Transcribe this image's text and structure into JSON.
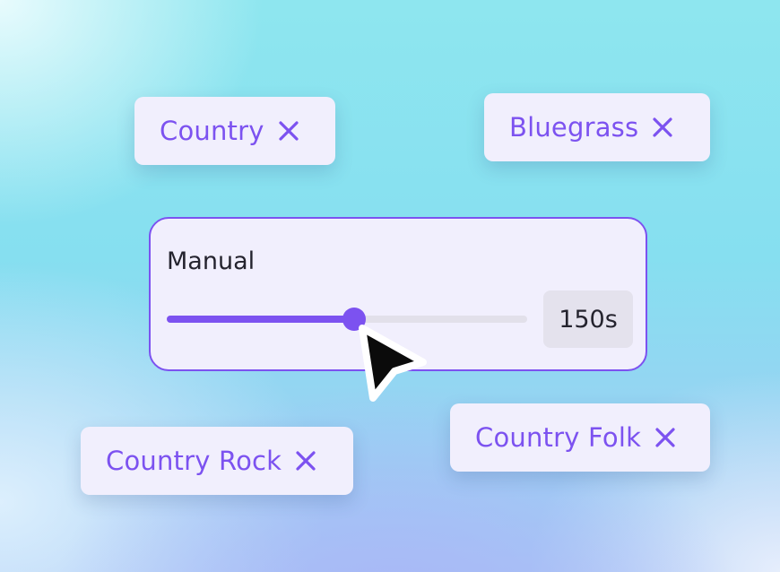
{
  "chips": [
    {
      "label": "Country"
    },
    {
      "label": "Bluegrass"
    },
    {
      "label": "Country Rock"
    },
    {
      "label": "Country Folk"
    }
  ],
  "slider": {
    "title": "Manual",
    "value_label": "150s",
    "fill_fraction": 0.52
  },
  "icons": {
    "chip_remove": "close-icon",
    "pointer": "cursor-arrow-icon"
  },
  "colors": {
    "accent": "#7c52f0",
    "chip_bg": "#f1effd",
    "text_dark": "#24232e",
    "track": "#e2e0ea"
  }
}
